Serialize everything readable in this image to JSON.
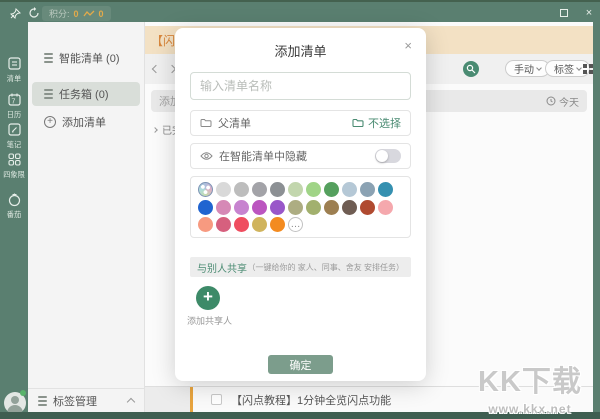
{
  "titlebar": {
    "points_label": "积分:",
    "points_value": "0",
    "trend_value": "0"
  },
  "rail": {
    "items": [
      {
        "label": "清单",
        "icon": "list-icon"
      },
      {
        "label": "日历",
        "icon": "calendar-icon"
      },
      {
        "label": "笔记",
        "icon": "note-icon"
      },
      {
        "label": "四象限",
        "icon": "quadrant-icon"
      },
      {
        "label": "番茄",
        "icon": "tomato-icon"
      }
    ]
  },
  "panel": {
    "smart_list_label": "智能清单 (0)",
    "inbox_label": "任务箱 (0)",
    "add_list_label": "添加清单",
    "tag_manage_label": "标签管理"
  },
  "main": {
    "banner_text": "【闪点教程】",
    "manual_button": "手动",
    "tag_button": "标签",
    "add_task_placeholder": "添加到",
    "today_label": "今天",
    "completed_group": "已完成",
    "task_title": "【闪点教程】1分钟全览闪点功能"
  },
  "modal": {
    "title": "添加清单",
    "close": "×",
    "name_placeholder": "输入清单名称",
    "parent_label": "父清单",
    "parent_value": "不选择",
    "hide_label": "在智能清单中隐藏",
    "more_glyph": "…",
    "share_label": "与别人共享",
    "share_hint": "（一键给你的 家人、同事、舍友 安排任务）",
    "add_member_plus": "+",
    "add_member_label": "添加共享人",
    "confirm_label": "确定",
    "palette": {
      "rows": [
        [
          "custom",
          "#d9d9d9",
          "#bdbdbd",
          "#a3a3a8",
          "#8c9094",
          "#c2d6ad",
          "#a0d487",
          "#55a05e",
          "#b5c8d6",
          "#8ba2b3",
          "#3590b0"
        ],
        [
          "#2064d0",
          "#d689b6",
          "#c783cf",
          "#bb55c0",
          "#9957c9",
          "#adad82",
          "#a2b06e",
          "#9d7f51",
          "#6f5d53",
          "#b04a30",
          "#f5a8ad"
        ],
        [
          "#f79a80",
          "#d6607e",
          "#ef4d5f",
          "#d0b45d",
          "#f38b20",
          "more"
        ]
      ]
    },
    "accent_color": "#4a8b72",
    "confirm_color": "#7c9d8c"
  },
  "watermark": {
    "line1": "KK下载",
    "line2": "www.kkx.net"
  }
}
